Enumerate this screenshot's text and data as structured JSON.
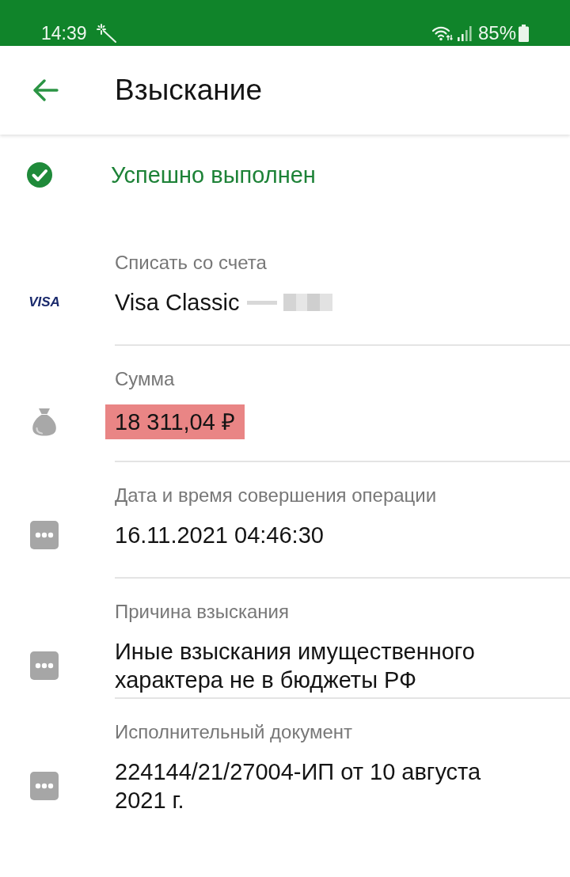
{
  "status_bar": {
    "time": "14:39",
    "battery_percent": "85%"
  },
  "app_bar": {
    "title": "Взыскание"
  },
  "result": {
    "text": "Успешно выполнен"
  },
  "fields": [
    {
      "kind": "card",
      "label": "Списать со счета",
      "logo": "VISA",
      "value": "Visa Classic",
      "number_masked": true
    },
    {
      "kind": "amount",
      "label": "Сумма",
      "value": "18 311,04 ₽",
      "highlighted": true
    },
    {
      "kind": "detail",
      "label": "Дата и время совершения операции",
      "value": "16.11.2021 04:46:30"
    },
    {
      "kind": "detail",
      "label": "Причина взыскания",
      "value": "Иные взыскания имущественного характера не в бюджеты РФ"
    },
    {
      "kind": "detail",
      "label": "Исполнительный документ",
      "value": "224144/21/27004-ИП от 10 августа 2021 г."
    }
  ]
}
